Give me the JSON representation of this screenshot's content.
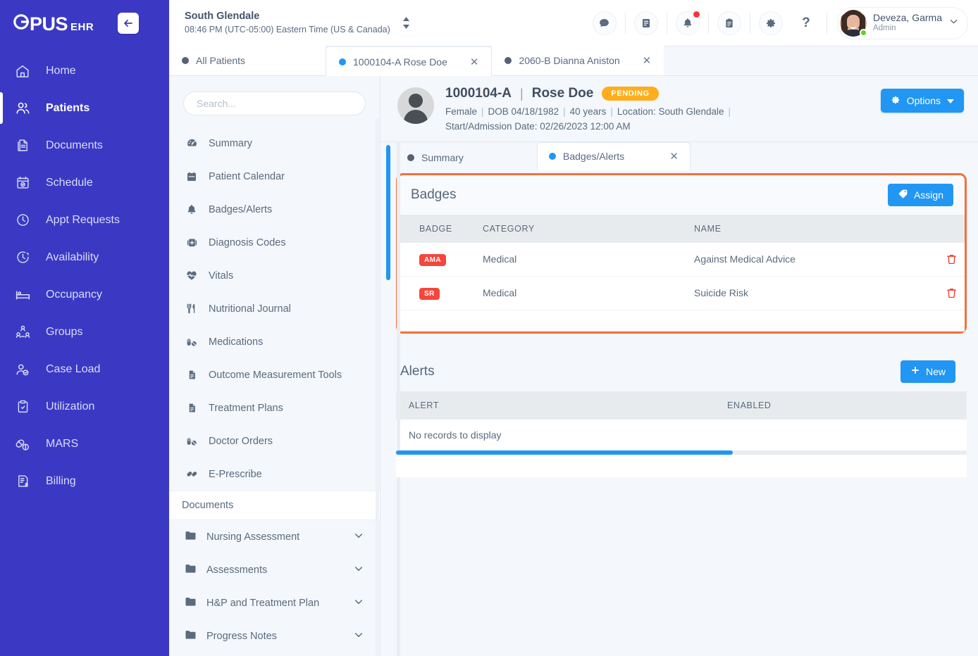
{
  "brand": {
    "logo_text": "PUS",
    "logo_leading": "O",
    "suffix": "EHR",
    "collapse_icon": "arrow-left-icon"
  },
  "sidebar": {
    "items": [
      {
        "label": "Home",
        "icon": "home-icon",
        "active": false
      },
      {
        "label": "Patients",
        "icon": "users-icon",
        "active": true
      },
      {
        "label": "Documents",
        "icon": "documents-icon",
        "active": false
      },
      {
        "label": "Schedule",
        "icon": "calendar-check-icon",
        "active": false
      },
      {
        "label": "Appt Requests",
        "icon": "clock-icon",
        "active": false
      },
      {
        "label": "Availability",
        "icon": "clock-dashed-icon",
        "active": false
      },
      {
        "label": "Occupancy",
        "icon": "bed-icon",
        "active": false
      },
      {
        "label": "Groups",
        "icon": "group-people-icon",
        "active": false
      },
      {
        "label": "Case Load",
        "icon": "user-check-icon",
        "active": false
      },
      {
        "label": "Utilization",
        "icon": "clipboard-check-icon",
        "active": false
      },
      {
        "label": "MARS",
        "icon": "pills-icon",
        "active": false
      },
      {
        "label": "Billing",
        "icon": "invoice-dollar-icon",
        "active": false
      }
    ]
  },
  "topbar": {
    "facility_name": "South Glendale",
    "facility_time": "08:46 PM (UTC-05:00) Eastern Time (US & Canada)",
    "facility_switch_icon": "sort-updown-icon",
    "tools": [
      {
        "name": "messages-icon",
        "glyph": "chat"
      },
      {
        "name": "notes-icon",
        "glyph": "book"
      },
      {
        "name": "notifications-icon",
        "glyph": "bell",
        "badge": true
      },
      {
        "name": "tasks-icon",
        "glyph": "clipboard"
      },
      {
        "name": "settings-icon",
        "glyph": "gear"
      },
      {
        "name": "help-icon",
        "glyph": "question"
      }
    ],
    "user": {
      "name": "Deveza, Garma",
      "role": "Admin",
      "chevron": "chevron-down-icon"
    }
  },
  "patient_tabs": [
    {
      "label": "All Patients",
      "active": false,
      "closable": false,
      "dot": "grey"
    },
    {
      "label": "1000104-A Rose Doe",
      "active": true,
      "closable": true,
      "dot": "blue"
    },
    {
      "label": "2060-B Dianna Aniston",
      "active": false,
      "closable": true,
      "dot": "grey"
    }
  ],
  "patient_menu": {
    "search_placeholder": "Search...",
    "search_value": "",
    "items": [
      {
        "label": "Summary",
        "icon": "dashboard-icon"
      },
      {
        "label": "Patient Calendar",
        "icon": "calendar-icon"
      },
      {
        "label": "Badges/Alerts",
        "icon": "bell-icon"
      },
      {
        "label": "Diagnosis Codes",
        "icon": "medical-bag-icon"
      },
      {
        "label": "Vitals",
        "icon": "heart-pulse-icon"
      },
      {
        "label": "Nutritional Journal",
        "icon": "utensils-icon"
      },
      {
        "label": "Medications",
        "icon": "pills-icon"
      },
      {
        "label": "Outcome Measurement Tools",
        "icon": "file-lines-icon"
      },
      {
        "label": "Treatment Plans",
        "icon": "file-lines-icon"
      },
      {
        "label": "Doctor Orders",
        "icon": "pills-icon"
      },
      {
        "label": "E-Prescribe",
        "icon": "capsules-icon"
      }
    ],
    "section_label": "Documents",
    "folders": [
      {
        "label": "Nursing Assessment",
        "icon": "folder-icon",
        "chevron": "chevron-down-icon"
      },
      {
        "label": "Assessments",
        "icon": "folder-icon",
        "chevron": "chevron-down-icon"
      },
      {
        "label": "H&P and Treatment Plan",
        "icon": "folder-icon",
        "chevron": "chevron-down-icon"
      },
      {
        "label": "Progress Notes",
        "icon": "folder-icon",
        "chevron": "chevron-down-icon"
      }
    ]
  },
  "patient_header": {
    "id": "1000104-A",
    "separator": "|",
    "name": "Rose Doe",
    "status": "PENDING",
    "gender": "Female",
    "dob": "DOB 04/18/1982",
    "age": "40 years",
    "location": "Location: South Glendale",
    "admission": "Start/Admission Date: 02/26/2023 12:00 AM",
    "options_label": "Options",
    "options_icon": "gear-icon",
    "options_caret": "caret-down-icon"
  },
  "inner_tabs": [
    {
      "label": "Summary",
      "active": false,
      "closable": false
    },
    {
      "label": "Badges/Alerts",
      "active": true,
      "closable": true
    }
  ],
  "badges_card": {
    "title": "Badges",
    "assign_label": "Assign",
    "assign_icon": "tag-icon",
    "columns": [
      "BADGE",
      "CATEGORY",
      "NAME"
    ],
    "rows": [
      {
        "badge": "AMA",
        "category": "Medical",
        "name": "Against Medical Advice",
        "delete_icon": "trash-icon"
      },
      {
        "badge": "SR",
        "category": "Medical",
        "name": "Suicide Risk",
        "delete_icon": "trash-icon"
      }
    ]
  },
  "alerts_card": {
    "title": "Alerts",
    "new_label": "New",
    "new_icon": "plus-icon",
    "columns": [
      "ALERT",
      "ENABLED"
    ],
    "empty_text": "No records to display",
    "hscroll_percent": 59
  },
  "colors": {
    "sidebar": "#3b39c4",
    "accent_blue": "#2196f3",
    "highlight_orange": "#f4703a",
    "badge_red": "#f5463c",
    "status_amber": "#ffad1d",
    "page_bg": "#f4f7fb"
  }
}
